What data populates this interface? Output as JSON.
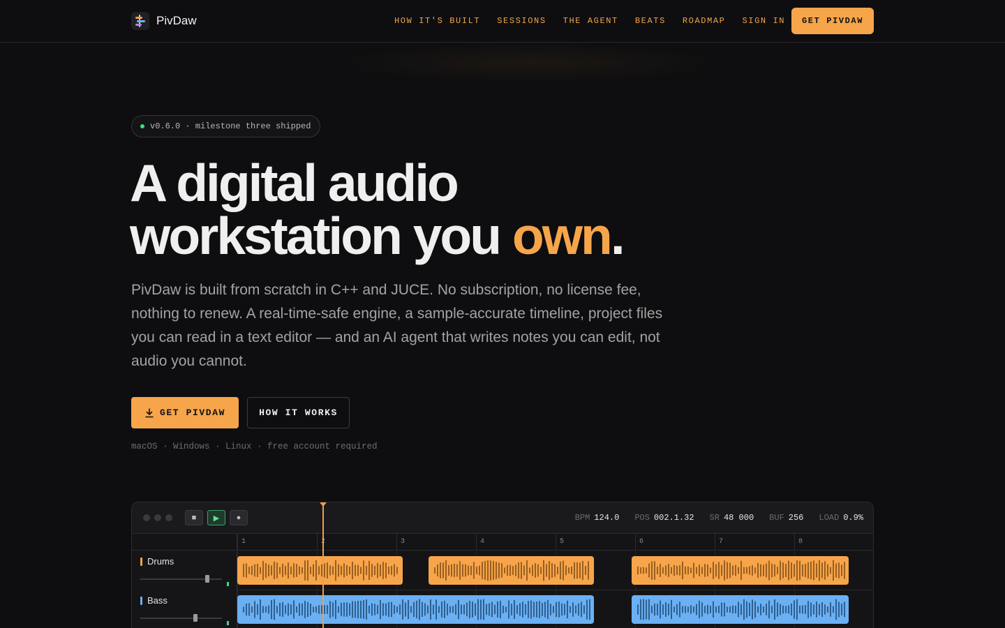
{
  "brand": {
    "name": "PivDaw"
  },
  "nav": {
    "links": [
      "HOW IT'S BUILT",
      "SESSIONS",
      "THE AGENT",
      "BEATS",
      "ROADMAP",
      "SIGN IN"
    ],
    "cta": "GET PIVDAW"
  },
  "hero": {
    "badge": "v0.6.0 · milestone three shipped",
    "headline_line1": "A digital audio",
    "headline_line2_pre": "workstation you ",
    "headline_accent": "own",
    "headline_end": ".",
    "subtitle": "PivDaw is built from scratch in C++ and JUCE. No subscription, no license fee, nothing to renew. A real-time-safe engine, a sample-accurate timeline, project files you can read in a text editor — and an AI agent that writes notes you can edit, not audio you cannot.",
    "primary_button": "GET PIVDAW",
    "secondary_button": "HOW IT WORKS",
    "platforms": "macOS · Windows · Linux · free account required"
  },
  "daw": {
    "transport": {
      "stop": "■",
      "play": "▶",
      "record": "●"
    },
    "stats": [
      {
        "key": "BPM",
        "value": "124.0"
      },
      {
        "key": "POS",
        "value": "002.1.32"
      },
      {
        "key": "SR",
        "value": "48 000"
      },
      {
        "key": "BUF",
        "value": "256"
      },
      {
        "key": "LOAD",
        "value": "0.9%"
      }
    ],
    "bars": [
      "1",
      "2",
      "3",
      "4",
      "5",
      "6",
      "7",
      "8"
    ],
    "tracks": [
      {
        "name": "Drums",
        "color": "#f7a54a",
        "wave_color": "#9a5f20",
        "fader": 0.83
      },
      {
        "name": "Bass",
        "color": "#6ab0f3",
        "wave_color": "#2f5f8f",
        "fader": 0.68
      }
    ]
  },
  "colors": {
    "accent": "#f7a54a",
    "background": "#0e0e10",
    "live_dot": "#3ddc84"
  }
}
